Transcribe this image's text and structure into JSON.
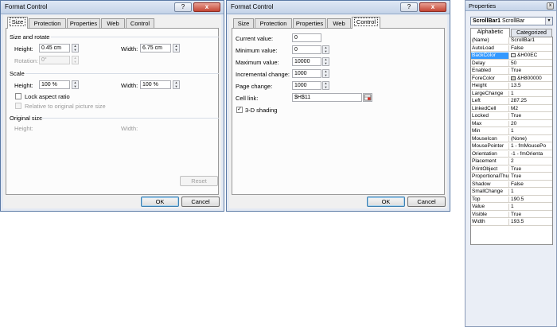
{
  "dialog1": {
    "title": "Format Control",
    "tabs": [
      "Size",
      "Protection",
      "Properties",
      "Web",
      "Control"
    ],
    "active_tab": "Size",
    "size_and_rotate": "Size and rotate",
    "height_label": "Height:",
    "height_value": "0.45 cm",
    "width_label": "Width:",
    "width_value": "6.75 cm",
    "rotation_label": "Rotation:",
    "rotation_value": "0°",
    "scale": "Scale",
    "scale_height_label": "Height:",
    "scale_height_value": "100 %",
    "scale_width_label": "Width:",
    "scale_width_value": "100 %",
    "lock_aspect": "Lock aspect ratio",
    "relative_original": "Relative to original picture size",
    "original_size": "Original size",
    "orig_height_label": "Height:",
    "orig_width_label": "Width:",
    "reset": "Reset",
    "ok": "OK",
    "cancel": "Cancel",
    "help_glyph": "?",
    "close_glyph": "x"
  },
  "dialog2": {
    "title": "Format Control",
    "tabs": [
      "Size",
      "Protection",
      "Properties",
      "Web",
      "Control"
    ],
    "active_tab": "Control",
    "current_value_label": "Current value:",
    "current_value": "0",
    "minimum_value_label": "Minimum value:",
    "minimum_value": "0",
    "maximum_value_label": "Maximum value:",
    "maximum_value": "10000",
    "incremental_change_label": "Incremental change:",
    "incremental_change": "1000",
    "page_change_label": "Page change:",
    "page_change": "1000",
    "cell_link_label": "Cell link:",
    "cell_link": "$H$11",
    "shading_label": "3-D shading",
    "shading_checked": "✓",
    "ok": "OK",
    "cancel": "Cancel",
    "help_glyph": "?",
    "close_glyph": "x"
  },
  "properties": {
    "title": "Properties",
    "close_glyph": "x",
    "object_name": "ScrollBar1",
    "object_type": "ScrollBar",
    "tabs": [
      "Alphabetic",
      "Categorized"
    ],
    "rows": [
      {
        "name": "(Name)",
        "value": "ScrollBar1"
      },
      {
        "name": "AutoLoad",
        "value": "False"
      },
      {
        "name": "BackColor",
        "value": "&H00EC",
        "swatch": "#ececec"
      },
      {
        "name": "Delay",
        "value": "50"
      },
      {
        "name": "Enabled",
        "value": "True"
      },
      {
        "name": "ForeColor",
        "value": "&H800000",
        "swatch": "#d4d0c8"
      },
      {
        "name": "Height",
        "value": "13.5"
      },
      {
        "name": "LargeChange",
        "value": "1"
      },
      {
        "name": "Left",
        "value": "287.25"
      },
      {
        "name": "LinkedCell",
        "value": "M2"
      },
      {
        "name": "Locked",
        "value": "True"
      },
      {
        "name": "Max",
        "value": "20"
      },
      {
        "name": "Min",
        "value": "1"
      },
      {
        "name": "MouseIcon",
        "value": "(None)"
      },
      {
        "name": "MousePointer",
        "value": "1 - fmMousePo"
      },
      {
        "name": "Orientation",
        "value": "-1 - fmOrienta"
      },
      {
        "name": "Placement",
        "value": "2"
      },
      {
        "name": "PrintObject",
        "value": "True"
      },
      {
        "name": "ProportionalThu",
        "value": "True"
      },
      {
        "name": "Shadow",
        "value": "False"
      },
      {
        "name": "SmallChange",
        "value": "1"
      },
      {
        "name": "Top",
        "value": "190.5"
      },
      {
        "name": "Value",
        "value": "1"
      },
      {
        "name": "Visible",
        "value": "True"
      },
      {
        "name": "Width",
        "value": "193.5"
      }
    ],
    "selected_row": "BackColor"
  }
}
